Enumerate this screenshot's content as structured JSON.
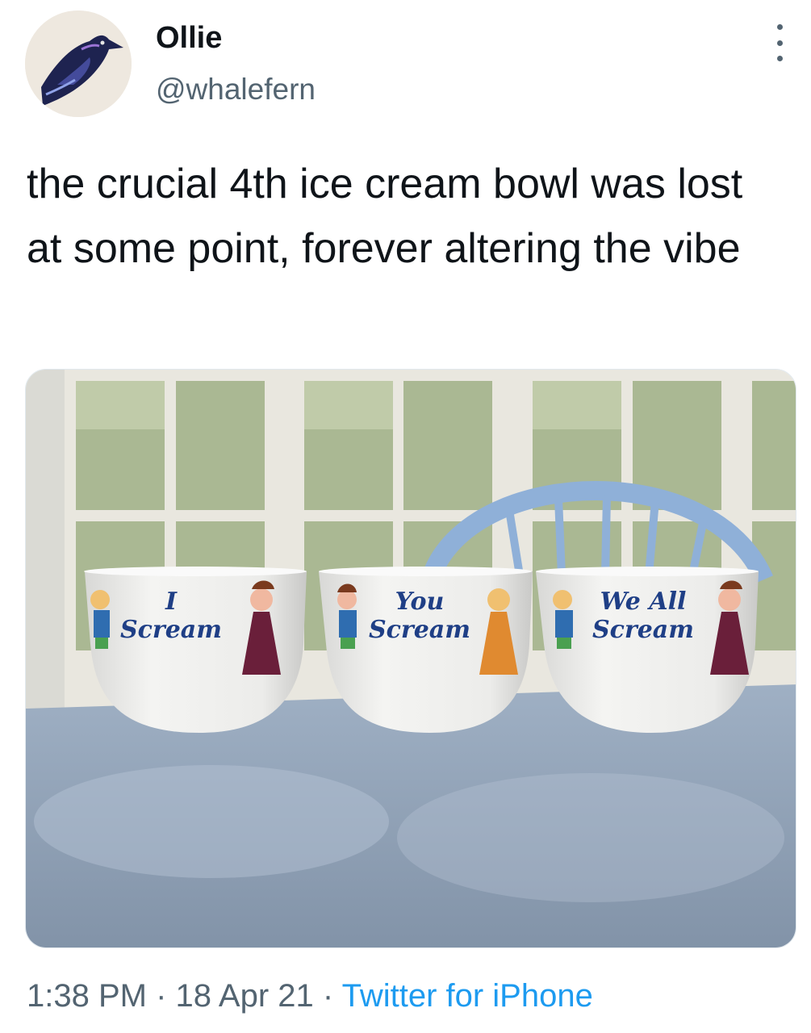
{
  "user": {
    "display_name": "Ollie",
    "handle": "@whalefern",
    "avatar_icon": "crow-icon"
  },
  "tweet": {
    "text": "the crucial 4th ice cream bowl was lost at some point, forever altering the vibe"
  },
  "media": {
    "bowls": [
      {
        "caption": [
          "I",
          "Scream"
        ]
      },
      {
        "caption": [
          "You",
          "Scream"
        ]
      },
      {
        "caption": [
          "We All",
          "Scream"
        ]
      }
    ]
  },
  "meta": {
    "time": "1:38 PM",
    "separator": " · ",
    "date": "18 Apr 21",
    "source": "Twitter for iPhone"
  },
  "colors": {
    "text_primary": "#0f1419",
    "text_secondary": "#536471",
    "link": "#1d9bf0"
  }
}
